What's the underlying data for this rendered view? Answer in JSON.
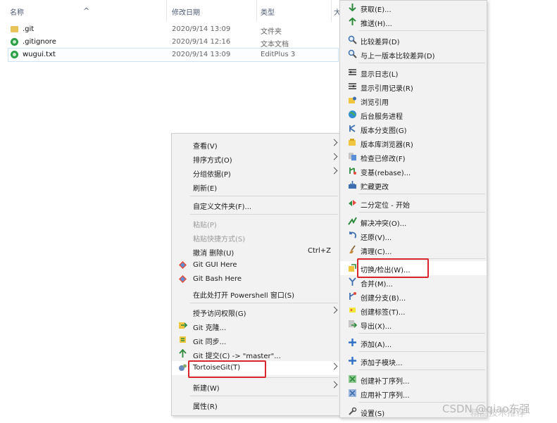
{
  "file_list": {
    "columns": {
      "name": "名称",
      "date": "修改日期",
      "type": "类型",
      "size": "大"
    },
    "files": [
      {
        "name": ".git",
        "date": "2020/9/14 13:09",
        "type": "文件夹",
        "icon": "folder-icon"
      },
      {
        "name": ".gitignore",
        "date": "2020/9/14 12:16",
        "type": "文本文档",
        "icon": "git-status-ok-icon"
      },
      {
        "name": "wugui.txt",
        "date": "2020/9/14 13:09",
        "type": "EditPlus 3",
        "icon": "git-status-ok-icon"
      }
    ]
  },
  "context_menu": {
    "view": "查看(V)",
    "sort": "排序方式(O)",
    "group": "分组依据(P)",
    "refresh": "刷新(E)",
    "customize": "自定义文件夹(F)...",
    "paste": "粘贴(P)",
    "paste_shortcut": "粘贴快捷方式(S)",
    "undo": "撤消 删除(U)",
    "undo_shortcut": "Ctrl+Z",
    "git_gui": "Git GUI Here",
    "git_bash": "Git Bash Here",
    "powershell": "在此处打开 Powershell 窗口(S)",
    "access": "授予访问权限(G)",
    "git_clone": "Git 克隆...",
    "git_sync": "Git 同步...",
    "git_commit": "Git 提交(C) -> \"master\"...",
    "tortoise": "TortoiseGit(T)",
    "new": "新建(W)",
    "properties": "属性(R)"
  },
  "tortoise_menu": {
    "items": [
      "获取(E)...",
      "推送(H)...",
      "比较差异(D)",
      "与上一版本比较差异(D)",
      "显示日志(L)",
      "显示引用记录(R)",
      "浏览引用",
      "后台服务进程",
      "版本分支图(G)",
      "版本库浏览器(R)",
      "检查已修改(F)",
      "变基(rebase)...",
      "贮藏更改",
      "二分定位 - 开始",
      "解决冲突(O)...",
      "还原(V)...",
      "清理(C)...",
      "切换/检出(W)...",
      "合并(M)...",
      "创建分支(B)...",
      "创建标签(T)...",
      "导出(X)...",
      "添加(A)...",
      "添加子模块...",
      "创建补丁序列...",
      "应用补丁序列...",
      "设置(S)"
    ]
  },
  "watermark": {
    "text1": "CSDN @qiao东强",
    "text2": "精品技术推荐"
  },
  "colors": {
    "highlight_box": "#d9262c",
    "menu_bg": "#f2f2f2"
  }
}
